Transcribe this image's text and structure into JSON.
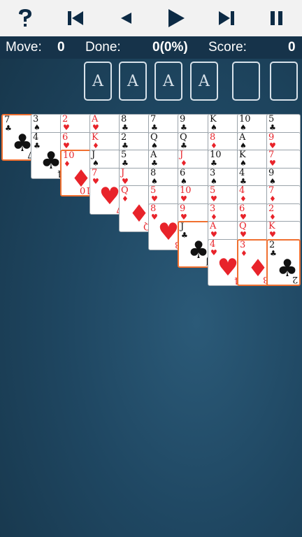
{
  "toolbar": {
    "icons": [
      "help-icon",
      "restart-icon",
      "undo-icon",
      "play-icon",
      "skip-icon",
      "pause-icon"
    ]
  },
  "status": {
    "move_label": "Move:",
    "move_value": "0",
    "done_label": "Done:",
    "done_value": "0(0%)",
    "score_label": "Score:",
    "score_value": "0"
  },
  "foundations": [
    "A",
    "A",
    "A",
    "A"
  ],
  "colors": {
    "red": "#e8232a",
    "black": "#111111",
    "selected": "#f07030",
    "background": "#1f4762"
  },
  "columns": [
    {
      "selected_last": true,
      "cards": [
        {
          "r": "7",
          "s": "♣"
        }
      ]
    },
    {
      "selected_last": false,
      "cards": [
        {
          "r": "3",
          "s": "♠"
        },
        {
          "r": "4",
          "s": "♣"
        }
      ]
    },
    {
      "selected_last": true,
      "cards": [
        {
          "r": "2",
          "s": "♥"
        },
        {
          "r": "6",
          "s": "♥"
        },
        {
          "r": "10",
          "s": "♦"
        }
      ]
    },
    {
      "selected_last": false,
      "cards": [
        {
          "r": "A",
          "s": "♥"
        },
        {
          "r": "K",
          "s": "♦"
        },
        {
          "r": "J",
          "s": "♠"
        },
        {
          "r": "7",
          "s": "♥"
        }
      ]
    },
    {
      "selected_last": false,
      "cards": [
        {
          "r": "8",
          "s": "♣"
        },
        {
          "r": "2",
          "s": "♣"
        },
        {
          "r": "5",
          "s": "♣"
        },
        {
          "r": "J",
          "s": "♥"
        },
        {
          "r": "Q",
          "s": "♦"
        }
      ]
    },
    {
      "selected_last": false,
      "cards": [
        {
          "r": "7",
          "s": "♣"
        },
        {
          "r": "Q",
          "s": "♠"
        },
        {
          "r": "A",
          "s": "♣"
        },
        {
          "r": "8",
          "s": "♠"
        },
        {
          "r": "5",
          "s": "♥"
        },
        {
          "r": "8",
          "s": "♥"
        }
      ]
    },
    {
      "selected_last": true,
      "cards": [
        {
          "r": "9",
          "s": "♣"
        },
        {
          "r": "Q",
          "s": "♣"
        },
        {
          "r": "J",
          "s": "♦"
        },
        {
          "r": "6",
          "s": "♠"
        },
        {
          "r": "10",
          "s": "♥"
        },
        {
          "r": "9",
          "s": "♥"
        },
        {
          "r": "J",
          "s": "♣"
        }
      ]
    },
    {
      "selected_last": false,
      "cards": [
        {
          "r": "K",
          "s": "♠"
        },
        {
          "r": "8",
          "s": "♦"
        },
        {
          "r": "10",
          "s": "♣"
        },
        {
          "r": "3",
          "s": "♠"
        },
        {
          "r": "5",
          "s": "♥"
        },
        {
          "r": "3",
          "s": "♦"
        },
        {
          "r": "A",
          "s": "♥"
        },
        {
          "r": "4",
          "s": "♥"
        }
      ]
    },
    {
      "selected_last": true,
      "cards": [
        {
          "r": "10",
          "s": "♠"
        },
        {
          "r": "A",
          "s": "♠"
        },
        {
          "r": "K",
          "s": "♠"
        },
        {
          "r": "4",
          "s": "♣"
        },
        {
          "r": "4",
          "s": "♦"
        },
        {
          "r": "6",
          "s": "♥"
        },
        {
          "r": "Q",
          "s": "♥"
        },
        {
          "r": "3",
          "s": "♦"
        }
      ]
    },
    {
      "selected_last": true,
      "cards": [
        {
          "r": "5",
          "s": "♣"
        },
        {
          "r": "9",
          "s": "♥"
        },
        {
          "r": "7",
          "s": "♥"
        },
        {
          "r": "9",
          "s": "♠"
        },
        {
          "r": "7",
          "s": "♦"
        },
        {
          "r": "2",
          "s": "♦"
        },
        {
          "r": "K",
          "s": "♥"
        },
        {
          "r": "2",
          "s": "♣"
        }
      ]
    }
  ]
}
